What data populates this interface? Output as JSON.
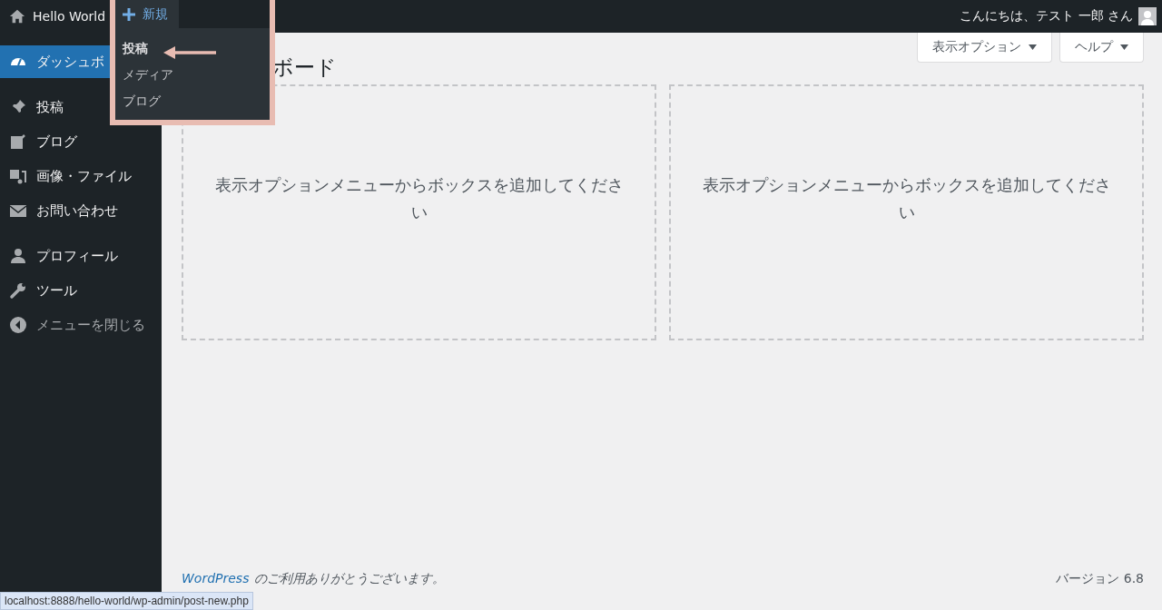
{
  "admin_bar": {
    "site_name": "Hello World",
    "new_menu": {
      "label": "新規",
      "expanded": true,
      "items": [
        {
          "label": "投稿",
          "selected": true
        },
        {
          "label": "メディア",
          "selected": false
        },
        {
          "label": "ブログ",
          "selected": false
        }
      ]
    },
    "greeting": "こんにちは、テスト 一郎 さん"
  },
  "sidebar": {
    "items": [
      {
        "label": "ダッシュボ",
        "selected": true
      },
      {
        "label": "投稿",
        "selected": false
      },
      {
        "label": "ブログ",
        "selected": false
      },
      {
        "label": "画像・ファイル",
        "selected": false
      },
      {
        "label": "お問い合わせ",
        "selected": false
      },
      {
        "label": "プロフィール",
        "selected": false
      },
      {
        "label": "ツール",
        "selected": false
      },
      {
        "label": "メニューを閉じる",
        "selected": false
      }
    ]
  },
  "page_title": "ボード",
  "screen_buttons": [
    "表示オプション",
    "ヘルプ"
  ],
  "boxes": [
    {
      "message": "表示オプションメニューからボックスを追加してください"
    },
    {
      "message": "表示オプションメニューからボックスを追加してください"
    }
  ],
  "footer": {
    "link": "WordPress",
    "text": "のご利用ありがとうございます。",
    "version": "バージョン 6.8"
  },
  "status_url": "localhost:8888/hello-world/wp-admin/post-new.php"
}
